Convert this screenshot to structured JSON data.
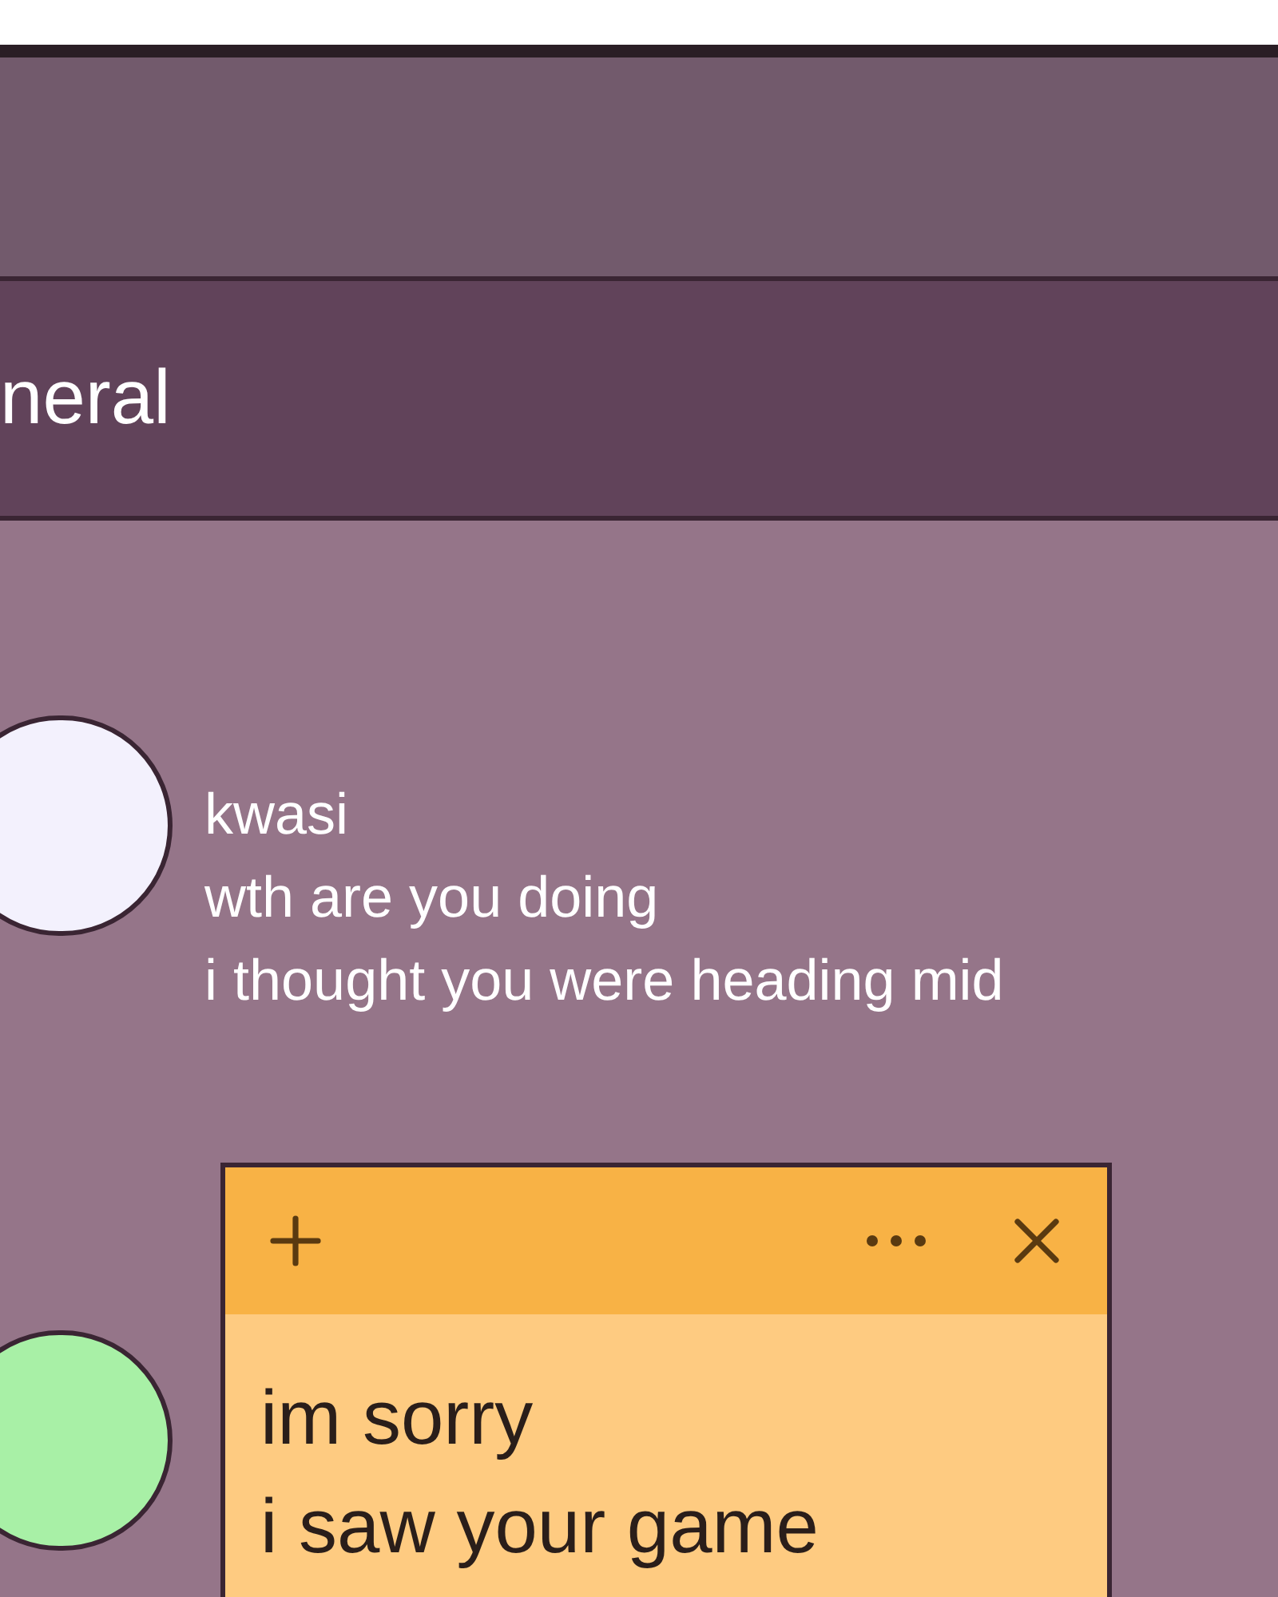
{
  "channel": {
    "title": "neral"
  },
  "messages": [
    {
      "author": "kwasi",
      "color": "#f3f1fd",
      "lines": [
        "wth are you doing",
        "i thought you were heading mid"
      ]
    },
    {
      "color": "#a8f0a6"
    }
  ],
  "sticky_note": {
    "lines": [
      "im sorry",
      "i saw your game"
    ]
  }
}
